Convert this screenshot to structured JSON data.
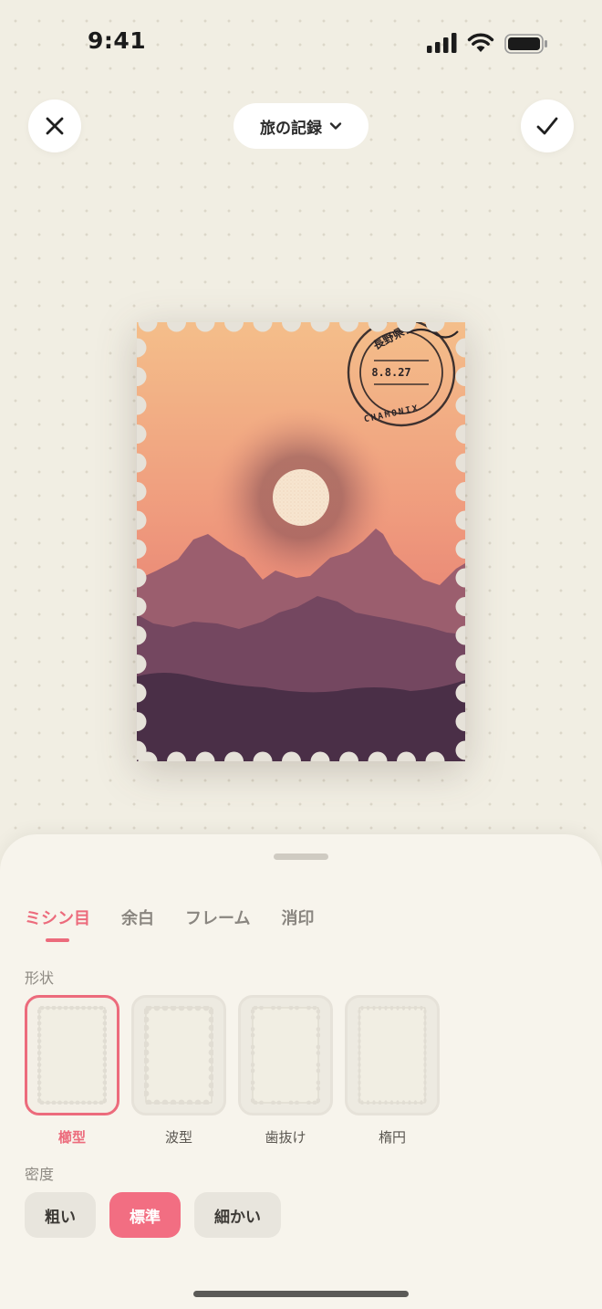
{
  "status_bar": {
    "time": "9:41",
    "signal_icon": "cellular-signal-icon",
    "wifi_icon": "wifi-icon",
    "battery_icon": "battery-icon"
  },
  "top_bar": {
    "close_icon": "close-icon",
    "album_title": "旅の記録",
    "album_chevron_icon": "chevron-down-icon",
    "confirm_icon": "checkmark-icon"
  },
  "stamp": {
    "postmark_text_top": "長野県",
    "postmark_date": "8.8.27",
    "postmark_place": "CHAMONIX",
    "colors": {
      "sky_top": "#f3bd8a",
      "sky_bottom": "#e67f72",
      "sun": "#f6e3cc",
      "mountain_far": "#9b5e6e",
      "mountain_mid": "#744760",
      "mountain_near": "#4a2f47",
      "perforation": "#e6e2d9"
    }
  },
  "sheet": {
    "tabs": [
      {
        "label": "ミシン目",
        "active": true
      },
      {
        "label": "余白",
        "active": false
      },
      {
        "label": "フレーム",
        "active": false
      },
      {
        "label": "消印",
        "active": false
      }
    ],
    "shape_label": "形状",
    "shapes": [
      {
        "label": "櫛型",
        "selected": true
      },
      {
        "label": "波型",
        "selected": false
      },
      {
        "label": "歯抜け",
        "selected": false
      },
      {
        "label": "楕円",
        "selected": false
      }
    ],
    "density_label": "密度",
    "density_options": [
      {
        "label": "粗い",
        "selected": false
      },
      {
        "label": "標準",
        "selected": true
      },
      {
        "label": "細かい",
        "selected": false
      }
    ],
    "accent_color": "#ec6b7c"
  }
}
